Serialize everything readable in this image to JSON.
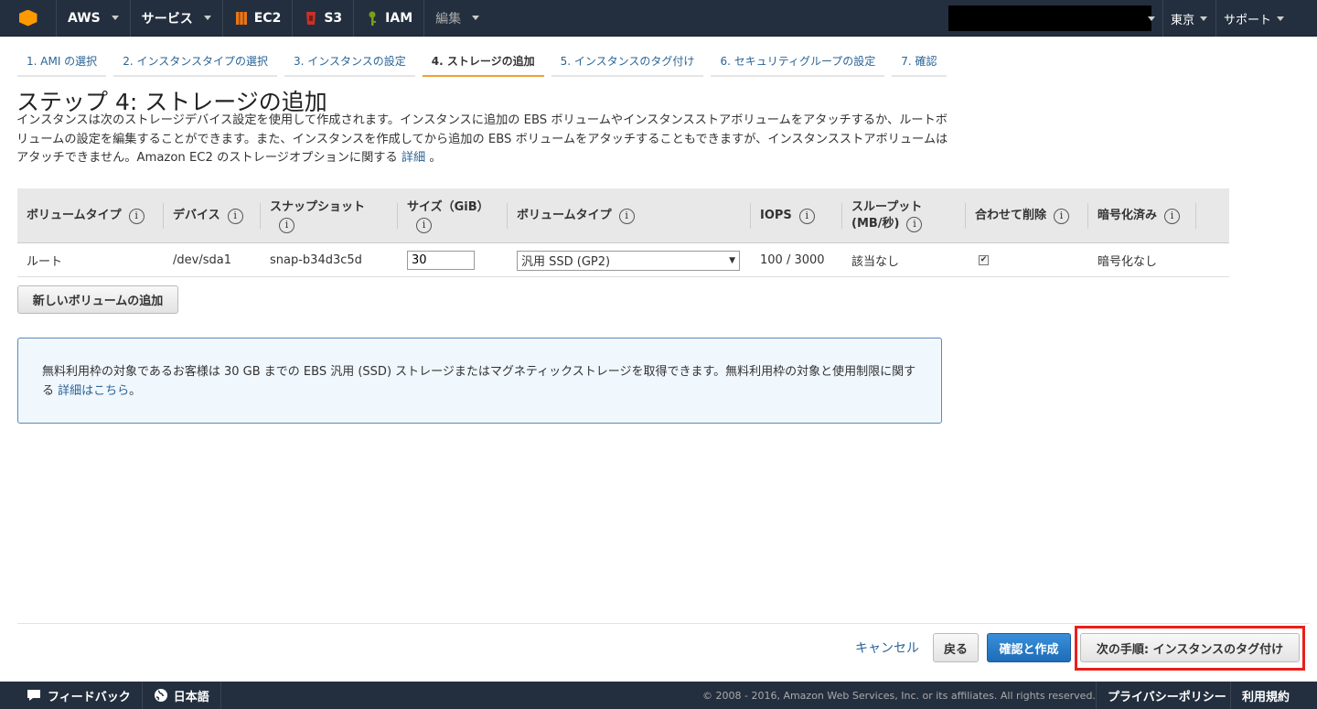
{
  "topnav": {
    "aws": "AWS",
    "services": "サービス",
    "ec2": "EC2",
    "s3": "S3",
    "iam": "IAM",
    "edit": "編集",
    "region": "東京",
    "support": "サポート"
  },
  "steps": [
    {
      "label": "1. AMI の選択",
      "active": false
    },
    {
      "label": "2. インスタンスタイプの選択",
      "active": false
    },
    {
      "label": "3. インスタンスの設定",
      "active": false
    },
    {
      "label": "4. ストレージの追加",
      "active": true
    },
    {
      "label": "5. インスタンスのタグ付け",
      "active": false
    },
    {
      "label": "6. セキュリティグループの設定",
      "active": false
    },
    {
      "label": "7. 確認",
      "active": false
    }
  ],
  "page": {
    "title": "ステップ 4: ストレージの追加",
    "description": "インスタンスは次のストレージデバイス設定を使用して作成されます。インスタンスに追加の EBS ボリュームやインスタンスストアボリュームをアタッチするか、ルートボリュームの設定を編集することができます。また、インスタンスを作成してから追加の EBS ボリュームをアタッチすることもできますが、インスタンスストアボリュームはアタッチできません。Amazon EC2 のストレージオプションに関する",
    "description_link": "詳細",
    "description_end": "。"
  },
  "table": {
    "headers": {
      "volume_type": "ボリュームタイプ",
      "device": "デバイス",
      "snapshot": "スナップショット",
      "size": "サイズ（GiB）",
      "volume_type2": "ボリュームタイプ",
      "iops": "IOPS",
      "throughput_1": "スループット",
      "throughput_2": "(MB/秒)",
      "delete_on_term": "合わせて削除",
      "encrypted": "暗号化済み"
    },
    "row": {
      "volume_type": "ルート",
      "device": "/dev/sda1",
      "snapshot": "snap-b34d3c5d",
      "size": "30",
      "volume_select": "汎用 SSD (GP2)",
      "iops": "100 / 3000",
      "throughput": "該当なし",
      "delete_on_term": true,
      "encrypted": "暗号化なし"
    },
    "info_glyph": "i"
  },
  "add_volume_button": "新しいボリュームの追加",
  "notice": {
    "text": "無料利用枠の対象であるお客様は 30 GB までの EBS 汎用 (SSD) ストレージまたはマグネティックストレージを取得できます。無料利用枠の対象と使用制限に関する",
    "link": "詳細はこちら",
    "end": "。"
  },
  "actions": {
    "cancel": "キャンセル",
    "back": "戻る",
    "review": "確認と作成",
    "next": "次の手順: インスタンスのタグ付け"
  },
  "footer": {
    "feedback": "フィードバック",
    "language": "日本語",
    "copyright": "© 2008 - 2016, Amazon Web Services, Inc. or its affiliates. All rights reserved.",
    "privacy": "プライバシーポリシー",
    "terms": "利用規約"
  },
  "colors": {
    "nav_bg": "#232f3e",
    "accent": "#f90",
    "link": "#2a6496",
    "primary": "#1d6cb8",
    "highlight": "#e8201a"
  }
}
